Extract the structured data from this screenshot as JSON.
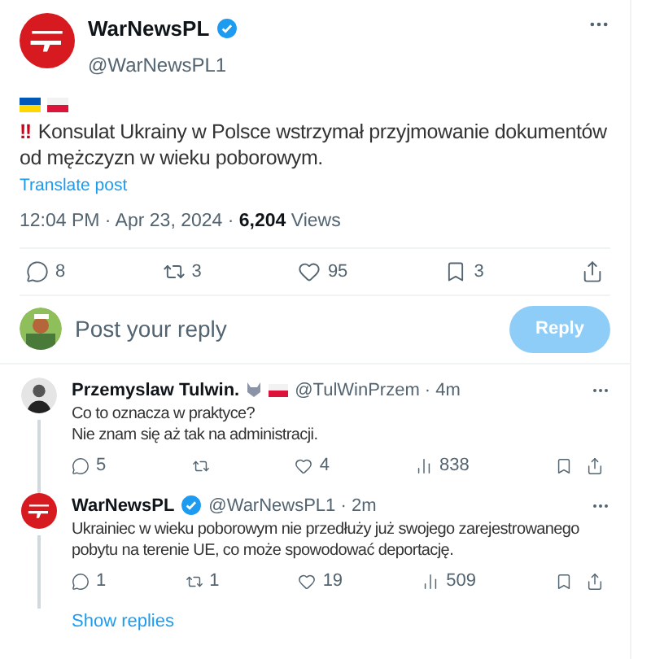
{
  "post": {
    "name": "WarNewsPL",
    "handle": "@WarNewsPL1",
    "verified": true,
    "alert": "‼",
    "text": "Konsulat Ukrainy w Polsce wstrzymał przyjmowanie dokumentów od mężczyzn w wieku poborowym.",
    "translate": "Translate post",
    "time": "12:04 PM · Apr 23, 2024 · ",
    "views": "6,204",
    "views_label": "Views",
    "stats": {
      "replies": "8",
      "reposts": "3",
      "likes": "95",
      "bookmarks": "3"
    }
  },
  "composer": {
    "placeholder": "Post your reply",
    "button": "Reply",
    "disabled": true
  },
  "replies": [
    {
      "kind": "person",
      "name": "Przemyslaw Tulwin.",
      "verified": false,
      "handle": "@TulWinPrzem · 4m",
      "lines": [
        "Co to oznacza w praktyce?",
        "Nie znam się aż tak na administracji."
      ],
      "replies": "5",
      "likes": "4",
      "views": "838"
    },
    {
      "kind": "logo",
      "name": "WarNewsPL",
      "verified": true,
      "handle": "@WarNewsPL1 · 2m",
      "lines": [
        "Ukrainiec w wieku poborowym nie przedłuży już swojego zarejestrowanego pobytu na terenie UE, co może spowodować deportację."
      ],
      "replies": "1",
      "reposts": "1",
      "likes": "19",
      "views": "509"
    }
  ],
  "show_replies": "Show replies"
}
